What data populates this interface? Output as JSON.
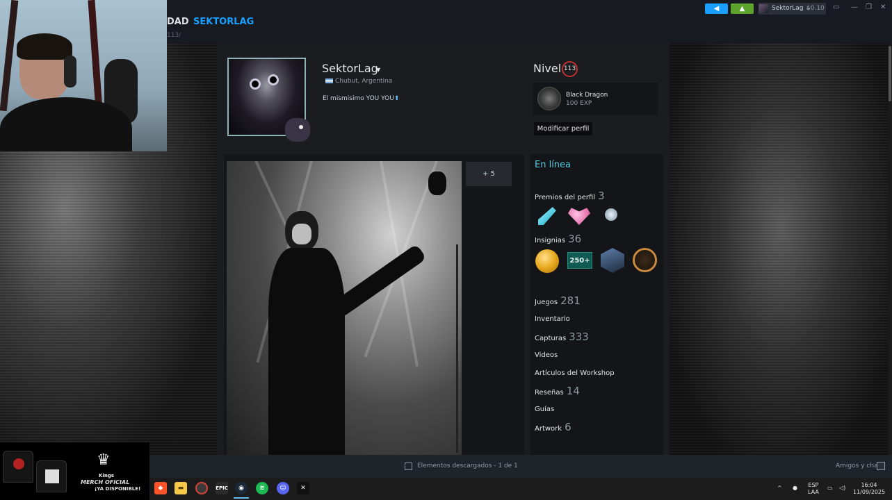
{
  "header": {
    "nav_prev": "DAD",
    "nav_active": "SEKTORLAG",
    "nav_url": "113/",
    "account_name": "SektorLag",
    "account_caret": "⌄",
    "balance": "$0.10"
  },
  "profile": {
    "persona_name": "SektorLag",
    "location": "Chubut, Argentina",
    "summary": "El mismisimo YOU YOU",
    "level_label": "Nivel",
    "level": "113",
    "badge_name": "Black Dragon",
    "badge_exp": "100 EXP",
    "edit_button": "Modificar perfil"
  },
  "showcase": {
    "more_label": "+ 5"
  },
  "sidebar": {
    "status": "En línea",
    "awards_label": "Premios del perfil",
    "awards_count": "3",
    "badges_label": "Insignias",
    "badges_count": "36",
    "badge_250": "250+",
    "games_label": "Juegos",
    "games_count": "281",
    "inventory_label": "Inventario",
    "screenshots_label": "Capturas",
    "screenshots_count": "333",
    "videos_label": "Videos",
    "workshop_label": "Artículos del Workshop",
    "reviews_label": "Reseñas",
    "reviews_count": "14",
    "guides_label": "Guías",
    "artwork_label": "Artwork",
    "artwork_count": "6"
  },
  "statusbar": {
    "downloads": "Elementos descargados - 1 de 1",
    "friends": "Amigos y chat"
  },
  "taskbar": {
    "icons": [
      "brave-icon",
      "file-explorer-icon",
      "chrome-icon",
      "epic-games-icon",
      "steam-icon",
      "spotify-icon",
      "discord-icon",
      "capcut-icon"
    ],
    "lang_top": "ESP",
    "lang_bottom": "LAA",
    "time": "16:04",
    "date": "11/09/2025"
  },
  "merch": {
    "brand": "Kings",
    "line1": "MERCH OFICIAL",
    "line2": "¡YA DISPONIBLE!"
  },
  "colors": {
    "steam_blue": "#1a9fff",
    "online_teal": "#57cbde",
    "notif_green": "#5ba32b",
    "level_red": "#c03030"
  }
}
